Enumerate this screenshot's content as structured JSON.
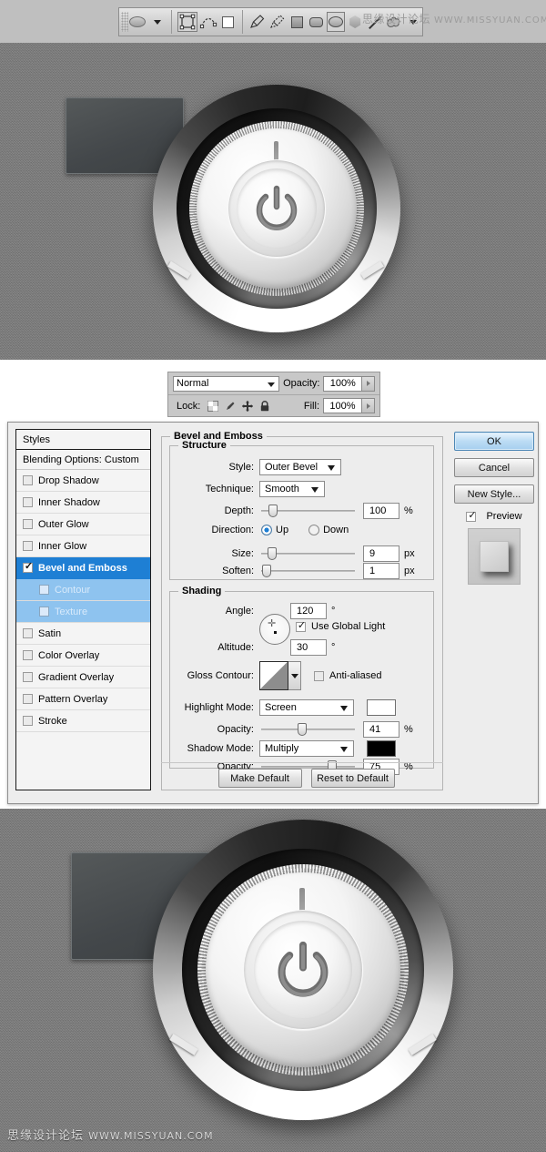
{
  "toolbar": {
    "shape_preset_label": "ellipse-shape-preset",
    "items": [
      {
        "name": "shape-preset-ellipse",
        "icon": "ellipse"
      },
      {
        "name": "preset-dropdown",
        "icon": "caret-down"
      },
      {
        "name": "tool-path-selection",
        "icon": "path-selection"
      },
      {
        "name": "tool-direct-selection",
        "icon": "direct-selection"
      },
      {
        "name": "tool-shape-layer",
        "icon": "square-outline"
      },
      {
        "name": "tool-pen",
        "icon": "pen"
      },
      {
        "name": "tool-freeform-pen",
        "icon": "freeform-pen"
      },
      {
        "name": "tool-rectangle",
        "icon": "rectangle"
      },
      {
        "name": "tool-rounded-rectangle",
        "icon": "rounded-rectangle"
      },
      {
        "name": "tool-ellipse",
        "icon": "ellipse"
      },
      {
        "name": "tool-polygon",
        "icon": "polygon"
      },
      {
        "name": "tool-line",
        "icon": "line"
      },
      {
        "name": "tool-custom-shape",
        "icon": "custom-shape"
      }
    ]
  },
  "watermark": {
    "cn": "思缘设计论坛",
    "url": "WWW.MISSYUAN.COM"
  },
  "layers_panel": {
    "blend_mode": "Normal",
    "opacity_label": "Opacity:",
    "opacity_value": "100%",
    "lock_label": "Lock:",
    "fill_label": "Fill:",
    "fill_value": "100%",
    "lock_icons": [
      "lock-transparent-pixels",
      "lock-image-pixels",
      "lock-position",
      "lock-all"
    ]
  },
  "dialog": {
    "styles": {
      "header": "Styles",
      "blending_options": "Blending Options: Custom",
      "items": [
        {
          "label": "Drop Shadow",
          "checked": false,
          "selected": false,
          "sub": false
        },
        {
          "label": "Inner Shadow",
          "checked": false,
          "selected": false,
          "sub": false
        },
        {
          "label": "Outer Glow",
          "checked": false,
          "selected": false,
          "sub": false
        },
        {
          "label": "Inner Glow",
          "checked": false,
          "selected": false,
          "sub": false
        },
        {
          "label": "Bevel and Emboss",
          "checked": true,
          "selected": true,
          "sub": false
        },
        {
          "label": "Contour",
          "checked": false,
          "selected": false,
          "sub": true
        },
        {
          "label": "Texture",
          "checked": false,
          "selected": false,
          "sub": true
        },
        {
          "label": "Satin",
          "checked": false,
          "selected": false,
          "sub": false
        },
        {
          "label": "Color Overlay",
          "checked": false,
          "selected": false,
          "sub": false
        },
        {
          "label": "Gradient Overlay",
          "checked": false,
          "selected": false,
          "sub": false
        },
        {
          "label": "Pattern Overlay",
          "checked": false,
          "selected": false,
          "sub": false
        },
        {
          "label": "Stroke",
          "checked": false,
          "selected": false,
          "sub": false
        }
      ]
    },
    "bevel": {
      "title": "Bevel and Emboss",
      "structure": {
        "title": "Structure",
        "style_label": "Style:",
        "style_value": "Outer Bevel",
        "technique_label": "Technique:",
        "technique_value": "Smooth",
        "depth_label": "Depth:",
        "depth_value": "100",
        "depth_unit": "%",
        "direction_label": "Direction:",
        "direction_up": "Up",
        "direction_down": "Down",
        "direction_selected": "Up",
        "size_label": "Size:",
        "size_value": "9",
        "size_unit": "px",
        "soften_label": "Soften:",
        "soften_value": "1",
        "soften_unit": "px"
      },
      "shading": {
        "title": "Shading",
        "angle_label": "Angle:",
        "angle_value": "120",
        "angle_unit": "°",
        "use_global_light": "Use Global Light",
        "use_global_light_checked": true,
        "altitude_label": "Altitude:",
        "altitude_value": "30",
        "altitude_unit": "°",
        "gloss_contour_label": "Gloss Contour:",
        "anti_aliased": "Anti-aliased",
        "anti_aliased_checked": false,
        "highlight_mode_label": "Highlight Mode:",
        "highlight_mode_value": "Screen",
        "highlight_color": "#ffffff",
        "highlight_opacity_label": "Opacity:",
        "highlight_opacity_value": "41",
        "highlight_opacity_unit": "%",
        "shadow_mode_label": "Shadow Mode:",
        "shadow_mode_value": "Multiply",
        "shadow_color": "#000000",
        "shadow_opacity_label": "Opacity:",
        "shadow_opacity_value": "75",
        "shadow_opacity_unit": "%"
      }
    },
    "buttons": {
      "ok": "OK",
      "cancel": "Cancel",
      "new_style": "New Style...",
      "preview": "Preview",
      "preview_checked": true,
      "make_default": "Make Default",
      "reset_to_default": "Reset to Default"
    }
  },
  "artwork": {
    "top_caption": "power-knob-preview-before",
    "bottom_caption": "power-knob-preview-after"
  },
  "colors": {
    "accent": "#1e7fd4",
    "texture_bg": "#7b7b7b",
    "plate": "#4a4d4d",
    "dialog_bg": "#ededed"
  }
}
